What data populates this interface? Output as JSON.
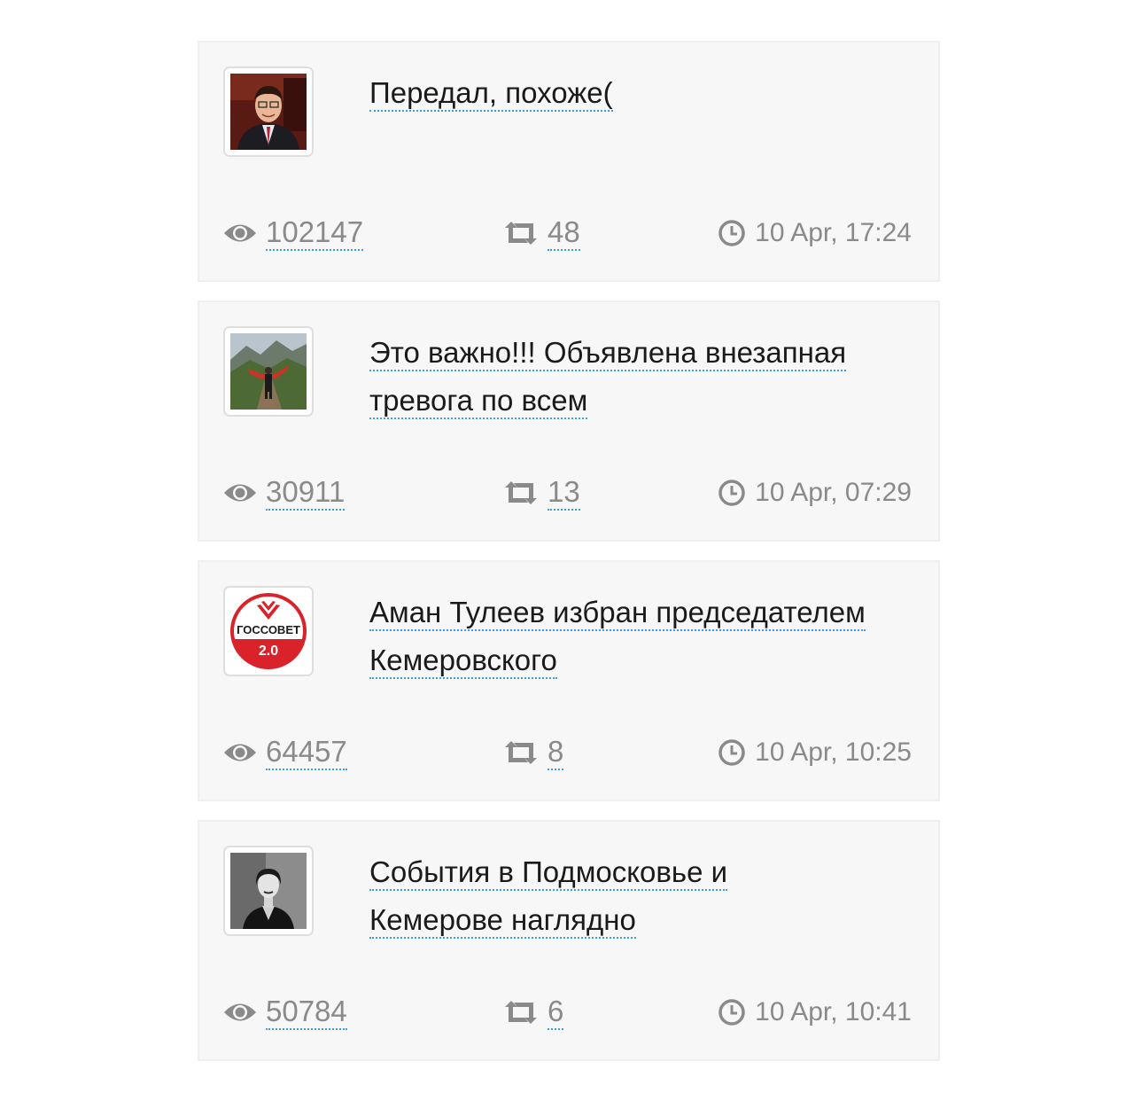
{
  "posts": [
    {
      "avatar": "man-in-suit-photo",
      "title": "Передал, похоже(",
      "views": "102147",
      "shares": "48",
      "time": "10 Apr, 17:24"
    },
    {
      "avatar": "hiker-mountain-photo",
      "title": "Это важно!!! Объявлена внезапная тревога по всем",
      "views": "30911",
      "shares": "13",
      "time": "10 Apr, 07:29"
    },
    {
      "avatar": "gossovet-logo",
      "logo_text_top": "ГОССОВЕТ",
      "logo_text_bottom": "2.0",
      "title": "Аман Тулеев избран председателем Кемеровского",
      "views": "64457",
      "shares": "8",
      "time": "10 Apr, 10:25"
    },
    {
      "avatar": "woman-bw-portrait",
      "title": "События в Подмосковье и Кемерове наглядно",
      "views": "50784",
      "shares": "6",
      "time": "10 Apr, 10:41"
    }
  ],
  "icons": {
    "views": "eye-icon",
    "shares": "retweet-icon",
    "time": "clock-icon"
  },
  "colors": {
    "link_underline": "#3aa0e0",
    "card_bg": "#f7f7f7",
    "stat_text": "#8a8a8a",
    "logo_red": "#d9222a"
  }
}
